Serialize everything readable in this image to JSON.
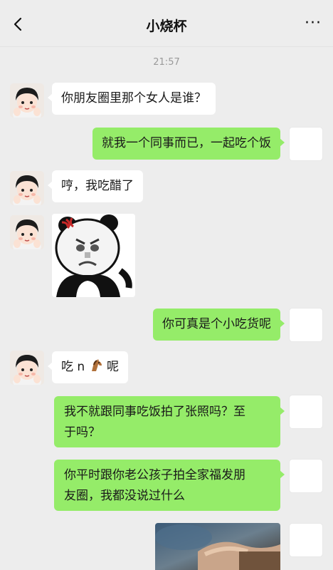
{
  "header": {
    "title": "小烧杯",
    "back_icon": "chevron-left-icon",
    "more_label": "···"
  },
  "timestamp": "21:57",
  "colors": {
    "background": "#ededed",
    "outgoing_bubble": "#95ec69",
    "incoming_bubble": "#ffffff"
  },
  "messages": [
    {
      "side": "incoming",
      "text": "你朋友圈里那个女人是谁？"
    },
    {
      "side": "outgoing",
      "text": "就我一个同事而已，一起吃个饭"
    },
    {
      "side": "incoming",
      "text": "哼，我吃醋了"
    },
    {
      "side": "incoming",
      "type": "sticker",
      "sticker": "angry-panda-meme"
    },
    {
      "side": "outgoing",
      "text": "你可真是个小吃货呢"
    },
    {
      "side": "incoming",
      "text_before": "吃 n",
      "emoji": "horse-emoji",
      "text_after": " 呢"
    },
    {
      "side": "outgoing",
      "line1": "我不就跟同事吃饭拍了张照吗？至",
      "line2": "于吗？"
    },
    {
      "side": "outgoing",
      "line1": "你平时跟你老公孩子拍全家福发朋",
      "line2": "友圈，我都没说过什么"
    },
    {
      "side": "outgoing",
      "type": "image",
      "image": "photo-thumbnail"
    }
  ]
}
